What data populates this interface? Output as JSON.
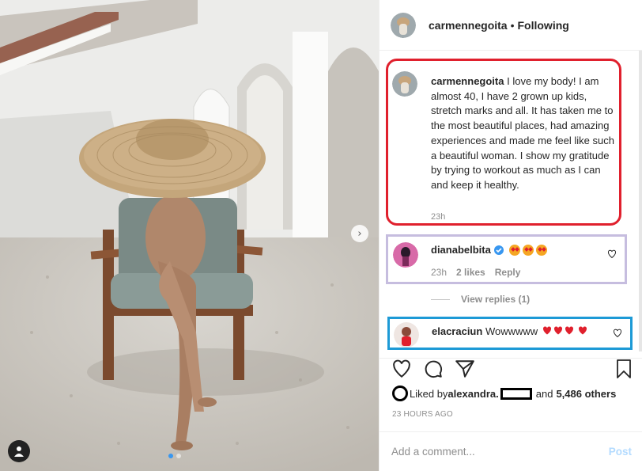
{
  "post": {
    "author": "carmennegoita",
    "separator": "•",
    "follow_status": "Following"
  },
  "caption": {
    "author": "carmennegoita",
    "text": " I love my body! I am almost 40, I have 2 grown up kids, stretch marks and all. It has taken me to the most beautiful places, had amazing experiences and made me feel like such a beautiful woman. I show my gratitude by trying to workout as much as I can and keep it healthy.",
    "time": "23h"
  },
  "comments": [
    {
      "author": "dianabelbita",
      "verified": true,
      "emoji_count": 3,
      "time": "23h",
      "likes": "2 likes",
      "reply_label": "Reply"
    },
    {
      "author": "elacraciun",
      "text": " Wowwwww",
      "heart_count": 4
    }
  ],
  "view_replies": "View replies (1)",
  "likes": {
    "prefix": "Liked by ",
    "user": "alexandra.",
    "middle": " and ",
    "count": "5,486 others"
  },
  "time_ago": "23 HOURS AGO",
  "add_comment": {
    "placeholder": "Add a comment...",
    "post_label": "Post"
  },
  "colors": {
    "caption_border": "#e0202d",
    "comment1_border": "#c6bddf",
    "comment2_border": "#1d9ad6",
    "post_button": "#b3dbff"
  },
  "icons": [
    "heart-icon",
    "comment-icon",
    "share-icon",
    "bookmark-icon",
    "chevron-right-icon",
    "user-tag-icon",
    "verified-icon"
  ]
}
